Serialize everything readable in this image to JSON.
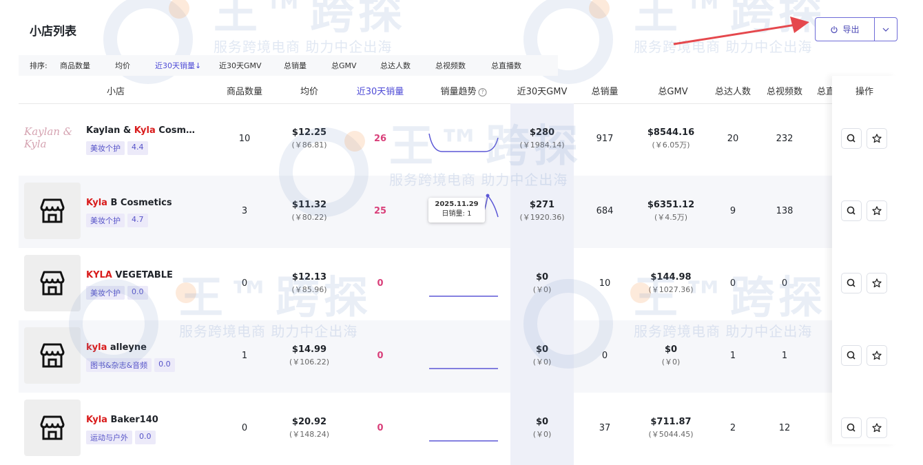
{
  "watermark": {
    "logo_text": "王™跨探",
    "slogan": "服务跨境电商 助力中企出海"
  },
  "page": {
    "title": "小店列表"
  },
  "toolbar": {
    "export_label": "导出"
  },
  "sort_bar": {
    "label": "排序:",
    "options": [
      "商品数量",
      "均价",
      "近30天销量↓",
      "近30天GMV",
      "总销量",
      "总GMV",
      "总达人数",
      "总视频数",
      "总直播数"
    ]
  },
  "columns": {
    "store": "小店",
    "product_count": "商品数量",
    "avg_price": "均价",
    "sales_30d": "近30天销量",
    "trend": "销量趋势",
    "gmv_30d": "近30天GMV",
    "total_sales": "总销量",
    "total_gmv": "总GMV",
    "total_creators": "总达人数",
    "total_videos": "总视频数",
    "total_live": "总直",
    "actions": "操作"
  },
  "tooltip": {
    "date": "2025.11.29",
    "text": "日销量: 1"
  },
  "rows": [
    {
      "logo_text": "Kaylan & Kyla",
      "name_pre": "Kaylan & ",
      "name_hl": "Kyla",
      "name_post": " Cosmet...",
      "category": "美妆个护",
      "rating": "4.4",
      "products": "10",
      "price": "$12.25",
      "price_cny": "(￥86.81)",
      "sales_30d": "26",
      "gmv_30d": "$280",
      "gmv_30d_cny": "(￥1984.14)",
      "total_sales": "917",
      "total_gmv": "$8544.16",
      "total_gmv_cny": "(￥6.05万)",
      "creators": "20",
      "videos": "232"
    },
    {
      "name_pre": "",
      "name_hl": "Kyla",
      "name_post": " B Cosmetics",
      "category": "美妆个护",
      "rating": "4.7",
      "products": "3",
      "price": "$11.32",
      "price_cny": "(￥80.22)",
      "sales_30d": "25",
      "gmv_30d": "$271",
      "gmv_30d_cny": "(￥1920.36)",
      "total_sales": "684",
      "total_gmv": "$6351.12",
      "total_gmv_cny": "(￥4.5万)",
      "creators": "9",
      "videos": "138"
    },
    {
      "name_pre": "",
      "name_hl": "KYLA",
      "name_post": " VEGETABLE",
      "category": "美妆个护",
      "rating": "0.0",
      "products": "0",
      "price": "$12.13",
      "price_cny": "(￥85.96)",
      "sales_30d": "0",
      "gmv_30d": "$0",
      "gmv_30d_cny": "(￥0)",
      "total_sales": "10",
      "total_gmv": "$144.98",
      "total_gmv_cny": "(￥1027.36)",
      "creators": "0",
      "videos": "0"
    },
    {
      "name_pre": "",
      "name_hl": "kyla",
      "name_post": " alleyne",
      "category": "图书&杂志&音频",
      "rating": "0.0",
      "products": "1",
      "price": "$14.99",
      "price_cny": "(￥106.22)",
      "sales_30d": "0",
      "gmv_30d": "$0",
      "gmv_30d_cny": "(￥0)",
      "total_sales": "0",
      "total_gmv": "$0",
      "total_gmv_cny": "(￥0)",
      "creators": "1",
      "videos": "1"
    },
    {
      "name_pre": "",
      "name_hl": "Kyla",
      "name_post": " Baker140",
      "category": "运动与户外",
      "rating": "0.0",
      "products": "0",
      "price": "$20.92",
      "price_cny": "(￥148.24)",
      "sales_30d": "0",
      "gmv_30d": "$0",
      "gmv_30d_cny": "(￥0)",
      "total_sales": "37",
      "total_gmv": "$711.87",
      "total_gmv_cny": "(￥5044.45)",
      "creators": "2",
      "videos": "12"
    }
  ],
  "colors": {
    "accent": "#4d4ad6",
    "highlight": "#d91c1c",
    "sales": "#d9407a",
    "arrow": "#e5484d"
  }
}
